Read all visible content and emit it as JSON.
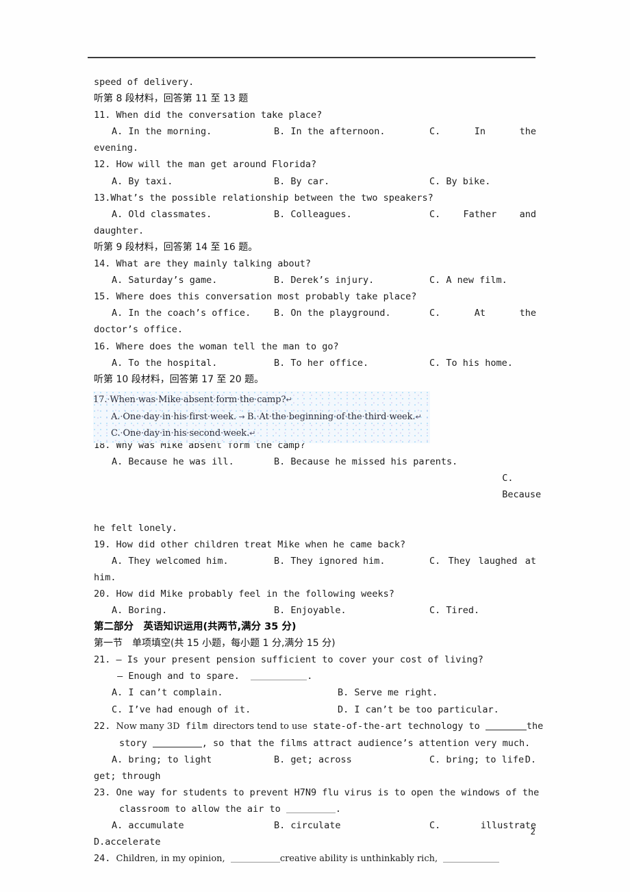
{
  "page": {
    "number": "2",
    "header_rule": true
  },
  "lines": {
    "l01_speed": "speed of delivery.",
    "l02_cn_sec8": "听第 8 段材料，回答第 11 至 13 题",
    "q11": {
      "stem": "11. When did the conversation take place?",
      "a": "A. In the morning.",
      "b": "B. In the afternoon.",
      "c_lead": "C.",
      "c_w1": "In",
      "c_w2": "the",
      "cont": "evening."
    },
    "q12": {
      "stem": "12. How will the man get around Florida?",
      "a": "A. By taxi.",
      "b": "B. By car.",
      "c": "C. By bike."
    },
    "q13": {
      "stem": "13.What’s the possible relationship between the two speakers?",
      "a": "A. Old classmates.",
      "b": "B. Colleagues.",
      "c_lead": "C.",
      "c_w1": "Father",
      "c_w2": "and",
      "cont": "daughter."
    },
    "l_cn_sec9": "听第 9 段材料，回答第 14 至 16 题。",
    "q14": {
      "stem": "14. What are they mainly talking about?",
      "a": "A. Saturday’s game.",
      "b": "B. Derek’s injury.",
      "c": "C. A new film."
    },
    "q15": {
      "stem": "15. Where does this conversation most probably take place?",
      "a": "A. In the coach’s office.",
      "b": "B. On the playground.",
      "c_lead": "C.",
      "c_w1": "At",
      "c_w2": "the",
      "cont": "doctor’s office."
    },
    "q16": {
      "stem": "16. Where does the woman tell the man to go?",
      "a": "A. To the hospital.",
      "b": "B. To her office.",
      "c": "C. To his home."
    },
    "l_cn_sec10": "听第 10 段材料，回答第 17 至 20 题。",
    "q17": {
      "stem": "17. When was Mike absent form the camp?",
      "a": "A. One day in his first week.",
      "b": "B. At the beginning of the third week.",
      "c": "C. One day in his second week.",
      "space_mark": "·",
      "return_mark": "↵",
      "tab_mark": "→"
    },
    "q18": {
      "stem": "18. Why was Mike absent form the camp?",
      "a": "A. Because he was ill.",
      "b": "B. Because he missed his parents.",
      "c_lead": "C.",
      "c_w1": "Because",
      "cont": "he felt lonely."
    },
    "q19": {
      "stem": "19. How did other children treat Mike when he came back?",
      "a": "A. They welcomed him.",
      "b": "B. They ignored him.",
      "c_lead": "C.",
      "c_w1": "They",
      "c_w2": "laughed",
      "c_w3": "at",
      "cont": "him."
    },
    "q20": {
      "stem": "20. How did Mike probably feel in the following weeks?",
      "a": "A. Boring.",
      "b": "B. Enjoyable.",
      "c": "C. Tired."
    },
    "part2_title": "第二部分　英语知识运用(共两节,满分 35 分)",
    "section1_title": "第一节　单项填空(共 15 小题，每小题 1 分,满分 15 分)",
    "q21": {
      "stem": "21. — Is your present pension sufficient to cover your cost of living?",
      "stem2_pre": " — Enough and to spare.  ",
      "stem2_post": ".",
      "a": "A. I can’t complain.",
      "b": "B. Serve me right.",
      "c": "C. I’ve had enough of it.",
      "d": "D. I can’t be too particular."
    },
    "q22": {
      "stem_a": "22. ",
      "stem_b": "Now many 3D",
      "stem_c": " film ",
      "stem_d": "directors tend to use",
      "stem_e": " state-of-the-art technology to ",
      "stem_f": "the",
      "stem2_pre": "story ",
      "stem2_post": ", so that the films attract audience’s attention very much.",
      "a": "A. bring; to light",
      "b": "B. get; across",
      "c": "C. bring; to life",
      "d_lead": "D.",
      "cont": "get; through"
    },
    "q23": {
      "stem": "23. One way for students to prevent H7N9 flu virus is to open the windows of the",
      "stem2_pre": "classroom to allow the air to ",
      "stem2_post": ".",
      "a": "A. accumulate",
      "b": "B. circulate",
      "c_lead": "C.",
      "c_w1": "illustrate",
      "d_lead": "D.",
      "cont": "accelerate"
    },
    "q24": {
      "stem_a": "24. ",
      "stem_b": "Children, ",
      "stem_c": "in my opinion,",
      "stem_d": " ",
      "stem_e": "creative ability is unthinkably rich,",
      "stem_f": " "
    }
  }
}
